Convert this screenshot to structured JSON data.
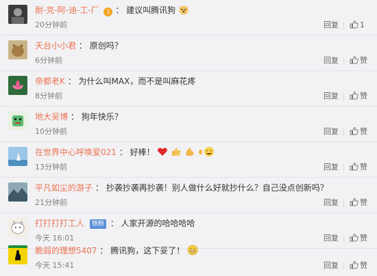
{
  "comments": [
    {
      "user": "耐-克-阿-迪-工-厂",
      "text": "建议叫腾讯狗",
      "time": "20分钟前",
      "reply": "回复",
      "like": "1",
      "vip": "1"
    },
    {
      "user": "天台小小君",
      "text": "原创吗？",
      "time": "6分钟前",
      "reply": "回复",
      "like": "赞"
    },
    {
      "user": "帝都老K",
      "text": "为什么叫MAX，而不是叫麻花疼",
      "time": "8分钟前",
      "reply": "回复",
      "like": "赞"
    },
    {
      "user": "地大吴博",
      "text": "狗年快乐？",
      "time": "10分钟前",
      "reply": "回复",
      "like": "赞"
    },
    {
      "user": "在世界中心呼唤爱021",
      "text": "好棒！",
      "time": "13分钟前",
      "reply": "回复",
      "like": "赞"
    },
    {
      "user": "平凡如尘的游子",
      "text": "抄袭抄袭再抄袭！别人做什么好就抄什么？自己没点创新吗？",
      "time": "21分钟前",
      "reply": "回复",
      "like": "赞"
    },
    {
      "user": "打打打打工人",
      "badge": "铁粉",
      "text": "人家开源的哈哈哈哈",
      "time": "今天 16:01",
      "reply": "回复",
      "like": "赞"
    },
    {
      "user": "脆弱的理想5407",
      "text": "腾讯狗，这下妥了！",
      "time": "今天 15:41",
      "reply": "回复",
      "like": "赞"
    }
  ],
  "colors": {
    "username": "#eb7350",
    "background": "#f2f2f5",
    "badge": "#5a8fd8"
  }
}
